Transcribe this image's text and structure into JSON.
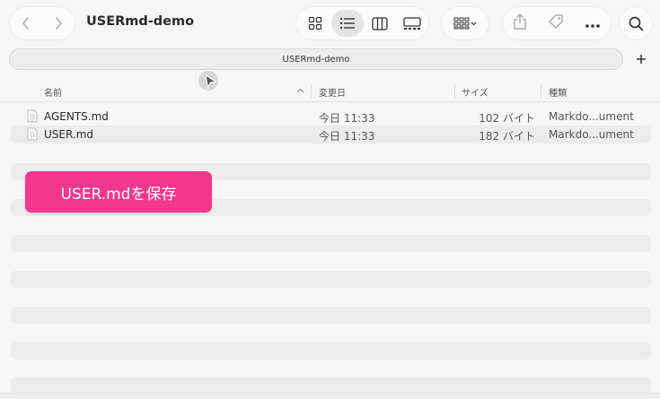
{
  "window": {
    "title": "USERmd-demo"
  },
  "toolbar": {
    "back_icon": "chevron-left-icon",
    "forward_icon": "chevron-right-icon",
    "views": [
      "icon-grid-view",
      "list-view",
      "column-view",
      "gallery-view"
    ],
    "active_view": "list-view",
    "group_icon": "group-by-icon",
    "actions": [
      "share-icon",
      "tag-icon",
      "more-icon"
    ],
    "search_icon": "search-icon"
  },
  "tabbar": {
    "tab_label": "USERmd-demo",
    "add_tab_label": "+"
  },
  "columns": {
    "name": "名前",
    "date": "変更日",
    "size": "サイズ",
    "kind": "種類"
  },
  "files": [
    {
      "name": "AGENTS.md",
      "date": "今日 11:33",
      "size": "102 バイト",
      "kind": "Markdo...ument"
    },
    {
      "name": "USER.md",
      "date": "今日 11:33",
      "size": "182 バイト",
      "kind": "Markdo...ument"
    }
  ],
  "overlay": {
    "save_button_label": "USER.mdを保存"
  },
  "colors": {
    "accent_pink": "#f2388e",
    "row_alt": "#ececec",
    "background": "#f6f6f6"
  }
}
